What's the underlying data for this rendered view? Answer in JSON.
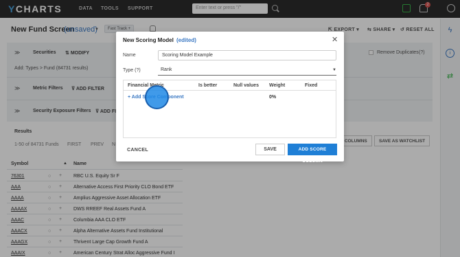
{
  "nav": {
    "logo_mark": "Y",
    "logo_text": "CHARTS",
    "links": [
      "DATA",
      "TOOLS",
      "SUPPORT"
    ],
    "search_placeholder": "Enter text or press \"/\"",
    "notif_count": "2"
  },
  "header": {
    "title": "New Fund Screen",
    "unsaved": "(unsaved)",
    "fast_track": "Fast Track",
    "export": "EXPORT",
    "share": "SHARE",
    "reset": "RESET ALL"
  },
  "filters": {
    "securities": "Securities",
    "modify": "MODIFY",
    "remove_duplicates": "Remove Duplicates",
    "help": "(?)",
    "add_types": "Add: Types > Fund (84731 results)",
    "metric_filters": "Metric Filters",
    "add_filter": "ADD FILTER",
    "security_exposure": "Security Exposure Filters",
    "add_filter_partial": "ADD FI"
  },
  "results": {
    "heading": "Results",
    "range": "1-50 of 84731 Funds",
    "first": "FIRST",
    "prev": "PREV",
    "next_partial": "N",
    "columns_partial": "O COLUMNS",
    "save_watchlist": "SAVE AS WATCHLIST",
    "col_symbol": "Symbol",
    "col_name": "Name",
    "rows": [
      {
        "symbol": "76301",
        "name": "RBC U.S. Equity Sr F"
      },
      {
        "symbol": "AAA",
        "name": "Alternative Access First Priority CLO Bond ETF"
      },
      {
        "symbol": "AAAA",
        "name": "Amplius Aggressive Asset Allocation ETF"
      },
      {
        "symbol": "AAAAX",
        "name": "DWS RREEF Real Assets Fund A"
      },
      {
        "symbol": "AAAC",
        "name": "Columbia AAA CLO ETF"
      },
      {
        "symbol": "AAACX",
        "name": "Alpha Alternative Assets Fund Institutional"
      },
      {
        "symbol": "AAAGX",
        "name": "Thrivent Large Cap Growth Fund A"
      },
      {
        "symbol": "AAAIX",
        "name": "American Century Strat Alloc Aggressive Fund I"
      }
    ]
  },
  "modal": {
    "title": "New Scoring Model",
    "edited": "(edited)",
    "name_label": "Name",
    "name_value": "Scoring Model Example",
    "type_label": "Type",
    "type_help": "(?)",
    "type_value": "Rank",
    "columns": [
      "Financial Metric",
      "Is better",
      "Null values",
      "Weight",
      "Fixed"
    ],
    "add_component": "+ Add Score Component",
    "weight_total": "0%",
    "cancel": "CANCEL",
    "save": "SAVE",
    "add_score_column": "ADD SCORE COLUMN"
  },
  "colors": {
    "accent": "#1f7fd6",
    "link": "#3a78c3",
    "topbar": "#2c2c2c"
  }
}
